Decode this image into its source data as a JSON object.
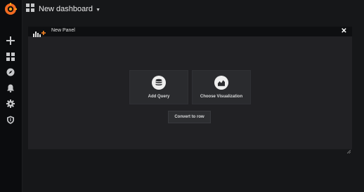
{
  "topbar": {
    "title": "New dashboard"
  },
  "panel": {
    "title": "New Panel",
    "close_symbol": "✕",
    "actions": [
      {
        "label": "Add Query",
        "icon": "database-icon"
      },
      {
        "label": "Choose Visualization",
        "icon": "chart-icon"
      }
    ],
    "convert_label": "Convert to row"
  },
  "sidebar": {
    "icons": [
      "grafana-logo",
      "plus-icon",
      "dashboards-icon",
      "explore-icon",
      "bell-icon",
      "gear-icon",
      "shield-icon"
    ]
  },
  "colors": {
    "background": "#161719",
    "panel": "#212124",
    "accent": "#f58220"
  }
}
